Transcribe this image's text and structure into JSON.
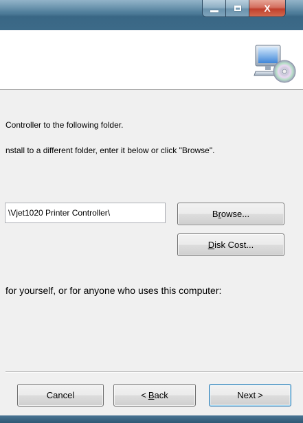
{
  "window": {
    "caption_buttons": {
      "minimize_icon": "minimize-icon",
      "maximize_icon": "maximize-icon",
      "close_label": "X"
    }
  },
  "banner": {
    "icon": "computer-cd-icon"
  },
  "body": {
    "line1": "Controller to the following folder.",
    "line2": "nstall to a different folder, enter it below or click \"Browse\".",
    "folder_value": "\\Vjet1020 Printer Controller\\",
    "install_for_text": "for yourself, or for anyone who uses this computer:"
  },
  "buttons": {
    "browse": {
      "mnemonic": "r",
      "before": "B",
      "after": "owse..."
    },
    "disk_cost": {
      "mnemonic": "D",
      "before": "",
      "after": "isk Cost..."
    },
    "cancel": {
      "label": "Cancel"
    },
    "back": {
      "arrow": "<",
      "mnemonic": "B",
      "after": "ack"
    },
    "next": {
      "label": "Next",
      "arrow": ">"
    }
  },
  "colors": {
    "titlebar": "#4d7b98",
    "close_button": "#c0402d",
    "dialog_bg": "#f0f0f0"
  }
}
